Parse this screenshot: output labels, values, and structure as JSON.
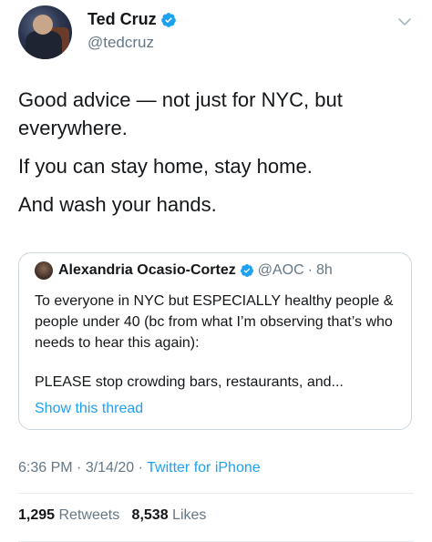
{
  "author": {
    "display_name": "Ted Cruz",
    "handle": "@tedcruz",
    "verified": true
  },
  "tweet": {
    "paragraphs": [
      "Good advice — not just for NYC, but everywhere.",
      "If you can stay home, stay home.",
      "And wash your hands."
    ]
  },
  "quoted_tweet": {
    "display_name": "Alexandria Ocasio-Cortez",
    "handle": "@AOC",
    "separator": "·",
    "time_ago": "8h",
    "paragraphs": [
      "To everyone in NYC but ESPECIALLY healthy people & people under 40 (bc from what I’m observing that’s who needs to hear this again):",
      "PLEASE stop crowding bars, restaurants, and..."
    ],
    "show_thread": "Show this thread"
  },
  "meta": {
    "time": "6:36 PM",
    "sep1": " · ",
    "date": "3/14/20",
    "sep2": " · ",
    "source": "Twitter for iPhone"
  },
  "stats": {
    "retweets_count": "1,295",
    "retweets_label": "Retweets",
    "likes_count": "8,538",
    "likes_label": "Likes"
  },
  "colors": {
    "accent": "#1da1f2",
    "secondary_text": "#657786",
    "primary_text": "#14171a"
  },
  "icons": {
    "verified": "verified-badge-icon",
    "menu": "chevron-down-icon"
  }
}
